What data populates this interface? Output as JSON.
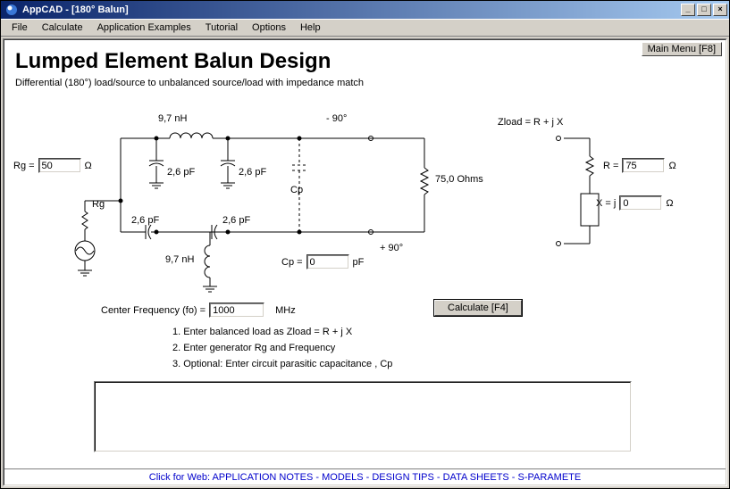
{
  "window": {
    "title": "AppCAD - [180° Balun]"
  },
  "menu": {
    "items": [
      "File",
      "Calculate",
      "Application Examples",
      "Tutorial",
      "Options",
      "Help"
    ],
    "main_menu_btn": "Main Menu [F8]"
  },
  "page": {
    "title": "Lumped Element Balun Design",
    "subtitle": "Differential (180°) load/source to unbalanced source/load with impedance match"
  },
  "schematic": {
    "L_top": "9,7 nH",
    "L_bot": "9,7 nH",
    "C1": "2,6 pF",
    "C2": "2,6 pF",
    "C3": "2,6 pF",
    "C4": "2,6 pF",
    "Cp_label": "Cp",
    "phase_neg": "- 90°",
    "phase_pos": "+ 90°",
    "load_ohms": "75,0 Ohms",
    "zload_eq": "Zload = R + j X",
    "Rg_label": "Rg ="
  },
  "inputs": {
    "Rg": {
      "label": "Rg =",
      "value": "50",
      "unit": "Ω"
    },
    "Cp": {
      "label": "Cp =",
      "value": "0",
      "unit": "pF"
    },
    "fo": {
      "label": "Center Frequency (fo) =",
      "value": "1000",
      "unit": "MHz"
    },
    "R": {
      "label": "R =",
      "value": "75",
      "unit": "Ω"
    },
    "X": {
      "label": "X = j",
      "value": "0",
      "unit": "Ω"
    }
  },
  "controls": {
    "calculate": "Calculate [F4]"
  },
  "instructions": {
    "line1": "1. Enter balanced load as Zload = R + j X",
    "line2": "2. Enter generator Rg and Frequency",
    "line3": "3. Optional: Enter circuit parasitic capacitance , Cp"
  },
  "footer": {
    "weblink": "Click for Web: APPLICATION NOTES - MODELS - DESIGN TIPS - DATA SHEETS - S-PARAMETE"
  }
}
